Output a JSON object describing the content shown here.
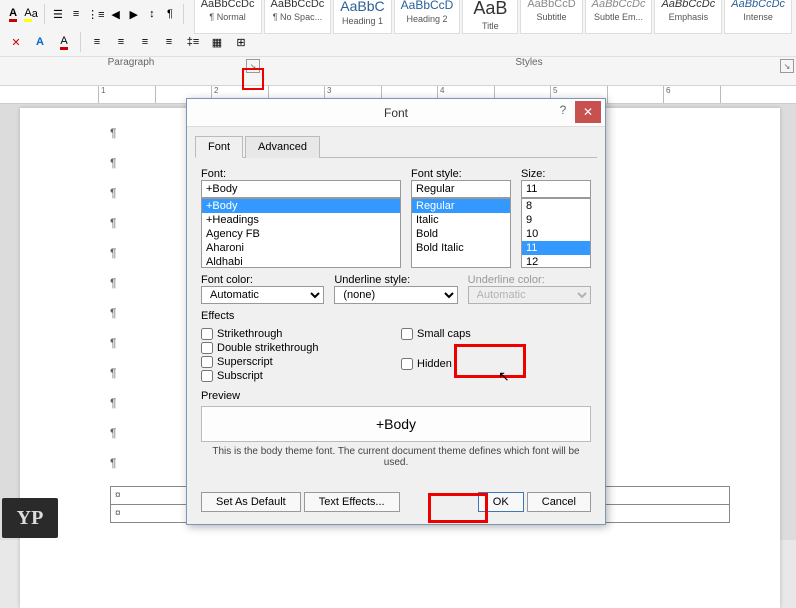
{
  "ribbon": {
    "paragraph_label": "Paragraph",
    "styles_label": "Styles",
    "styles": [
      {
        "sample": "AaBbCcDc",
        "name": "¶ Normal"
      },
      {
        "sample": "AaBbCcDc",
        "name": "¶ No Spac..."
      },
      {
        "sample": "AaBbC",
        "name": "Heading 1"
      },
      {
        "sample": "AaBbCcD",
        "name": "Heading 2"
      },
      {
        "sample": "AaB",
        "name": "Title"
      },
      {
        "sample": "AaBbCcD",
        "name": "Subtitle"
      },
      {
        "sample": "AaBbCcDc",
        "name": "Subtle Em..."
      },
      {
        "sample": "AaBbCcDc",
        "name": "Emphasis"
      },
      {
        "sample": "AaBbCcDc",
        "name": "Intense"
      }
    ]
  },
  "ruler": [
    "1",
    "",
    "2",
    "",
    "3",
    "",
    "4",
    "",
    "5",
    "",
    "6",
    ""
  ],
  "dialog": {
    "title": "Font",
    "tab_font": "Font",
    "tab_advanced": "Advanced",
    "font_label": "Font:",
    "font_value": "+Body",
    "font_list": [
      "+Body",
      "+Headings",
      "Agency FB",
      "Aharoni",
      "Aldhabi"
    ],
    "style_label": "Font style:",
    "style_value": "Regular",
    "style_list": [
      "Regular",
      "Italic",
      "Bold",
      "Bold Italic"
    ],
    "size_label": "Size:",
    "size_value": "11",
    "size_list": [
      "8",
      "9",
      "10",
      "11",
      "12"
    ],
    "font_color_label": "Font color:",
    "font_color_value": "Automatic",
    "underline_style_label": "Underline style:",
    "underline_style_value": "(none)",
    "underline_color_label": "Underline color:",
    "underline_color_value": "Automatic",
    "effects_label": "Effects",
    "eff_strike": "Strikethrough",
    "eff_dstrike": "Double strikethrough",
    "eff_super": "Superscript",
    "eff_sub": "Subscript",
    "eff_small": "Small caps",
    "eff_hidden": "Hidden",
    "preview_label": "Preview",
    "preview_text": "+Body",
    "preview_note": "This is the body theme font. The current document theme defines which font will be used.",
    "btn_default": "Set As Default",
    "btn_effects": "Text Effects...",
    "btn_ok": "OK",
    "btn_cancel": "Cancel"
  },
  "pilcrow": "¶",
  "table_cell": "¤"
}
